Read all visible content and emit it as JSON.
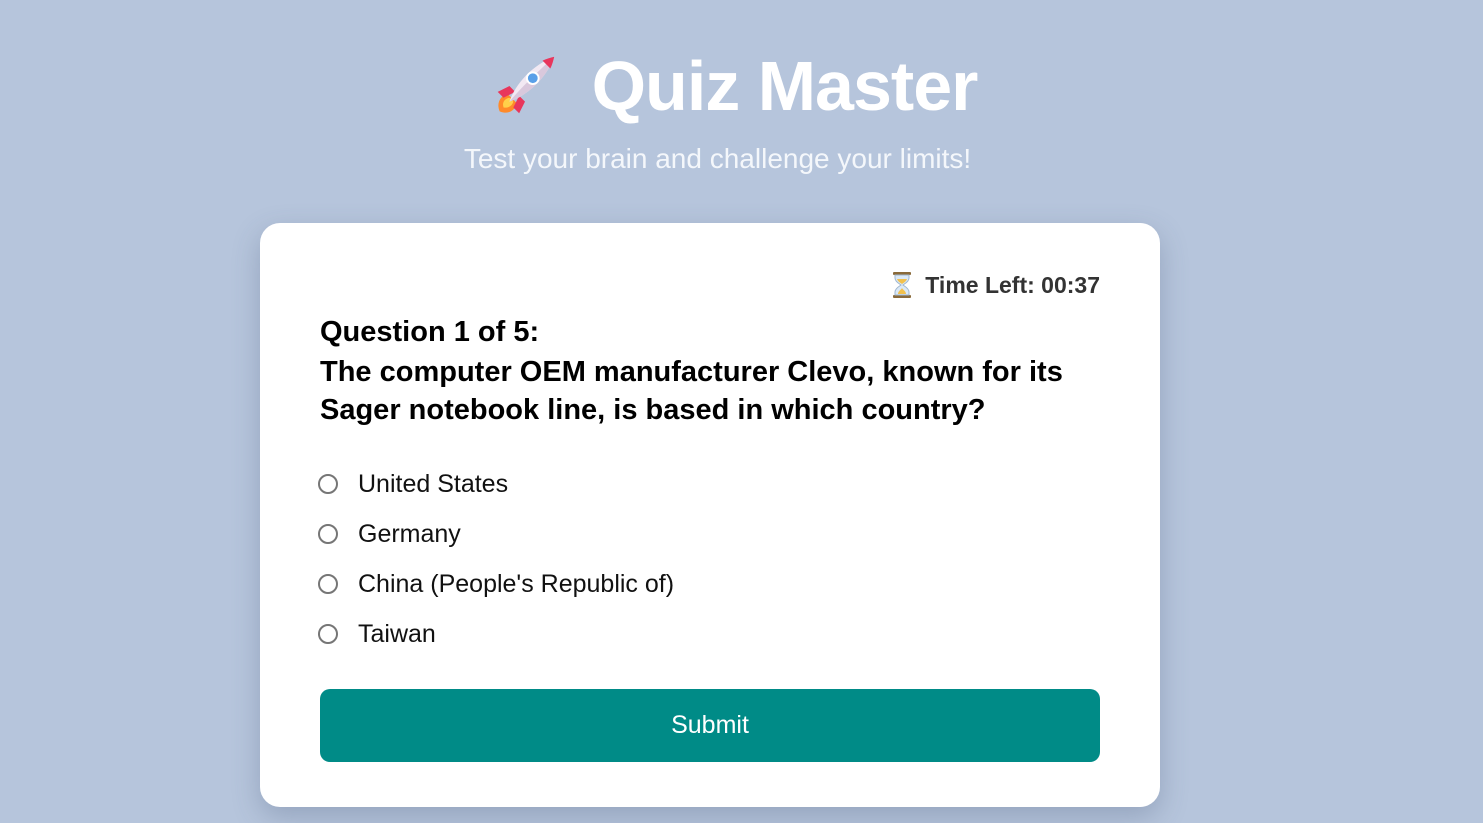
{
  "header": {
    "rocket_icon": "rocket-icon",
    "title": "Quiz Master",
    "subtitle": "Test your brain and challenge your limits!"
  },
  "timer": {
    "icon": "hourglass-icon",
    "label": "Time Left: 00:37"
  },
  "question": {
    "label": "Question 1 of 5:",
    "text": "The computer OEM manufacturer Clevo, known for its Sager notebook line, is based in which country?"
  },
  "options": [
    {
      "label": "United States"
    },
    {
      "label": "Germany"
    },
    {
      "label": "China (People's Republic of)"
    },
    {
      "label": "Taiwan"
    }
  ],
  "submit": {
    "label": "Submit"
  },
  "colors": {
    "background": "#b6c5dc",
    "card": "#ffffff",
    "accent": "#008b87"
  }
}
